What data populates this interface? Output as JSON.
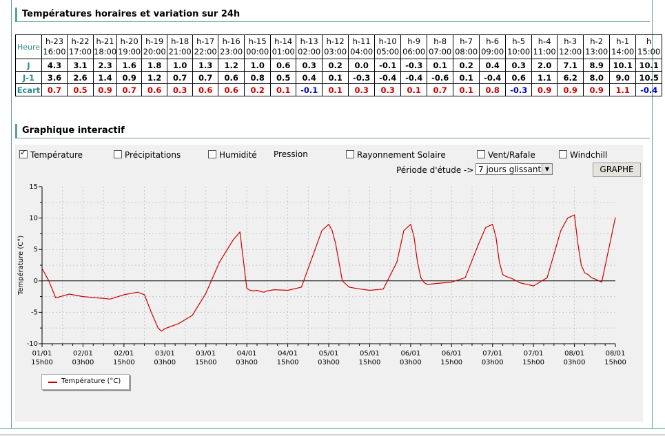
{
  "section1": {
    "title": "Températures horaires et variation sur 24h"
  },
  "table": {
    "row_labels": {
      "hour": "Heure",
      "j": "J",
      "j1": "J-1",
      "ecart": "Ecart"
    },
    "hours": [
      "h-23",
      "h-22",
      "h-21",
      "h-20",
      "h-19",
      "h-18",
      "h-17",
      "h-16",
      "h-15",
      "h-14",
      "h-13",
      "h-12",
      "h-11",
      "h-10",
      "h-9",
      "h-8",
      "h-7",
      "h-6",
      "h-5",
      "h-4",
      "h-3",
      "h-2",
      "h-1",
      "h"
    ],
    "times": [
      "16:00",
      "17:00",
      "18:00",
      "19:00",
      "20:00",
      "21:00",
      "22:00",
      "23:00",
      "00:00",
      "01:00",
      "02:00",
      "03:00",
      "04:00",
      "05:00",
      "06:00",
      "07:00",
      "08:00",
      "09:00",
      "10:00",
      "11:00",
      "12:00",
      "13:00",
      "14:00",
      "15:00"
    ],
    "j": [
      "4.3",
      "3.1",
      "2.3",
      "1.6",
      "1.8",
      "1.0",
      "1.3",
      "1.2",
      "1.0",
      "0.6",
      "0.3",
      "0.2",
      "0.0",
      "-0.1",
      "-0.3",
      "0.1",
      "0.2",
      "0.4",
      "0.3",
      "2.0",
      "7.1",
      "8.9",
      "10.1",
      "10.1"
    ],
    "j1": [
      "3.6",
      "2.6",
      "1.4",
      "0.9",
      "1.2",
      "0.7",
      "0.7",
      "0.6",
      "0.8",
      "0.5",
      "0.4",
      "0.1",
      "-0.3",
      "-0.4",
      "-0.4",
      "-0.6",
      "0.1",
      "-0.4",
      "0.6",
      "1.1",
      "6.2",
      "8.0",
      "9.0",
      "10.5"
    ],
    "ecart": [
      "0.7",
      "0.5",
      "0.9",
      "0.7",
      "0.6",
      "0.3",
      "0.6",
      "0.6",
      "0.2",
      "0.1",
      "-0.1",
      "0.1",
      "0.3",
      "0.3",
      "0.1",
      "0.7",
      "0.1",
      "0.8",
      "-0.3",
      "0.9",
      "0.9",
      "0.9",
      "1.1",
      "-0.4"
    ]
  },
  "section2": {
    "title": "Graphique interactif"
  },
  "options": {
    "temperature": {
      "label": "Température",
      "checked": true
    },
    "precipitations": {
      "label": "Précipitations",
      "checked": false
    },
    "humidite": {
      "label": "Humidité",
      "checked": false
    },
    "pression": {
      "label": "Pression"
    },
    "rayonnement": {
      "label": "Rayonnement Solaire",
      "checked": false
    },
    "vent": {
      "label": "Vent/Rafale",
      "checked": false
    },
    "windchill": {
      "label": "Windchill",
      "checked": false
    }
  },
  "period": {
    "label": "Période d'étude ->",
    "value": "7 jours glissant"
  },
  "graph_button": "GRAPHE",
  "colors": {
    "accent": "#5f9ea0",
    "positive": "#cc0000",
    "negative": "#0000cc",
    "series": "#cc0000"
  },
  "chart_data": {
    "type": "line",
    "ylabel": "Température (C°)",
    "ylim": [
      -10,
      15
    ],
    "yticks": [
      -10,
      -5,
      0,
      5,
      10,
      15
    ],
    "grid": true,
    "legend_position": "bottom-left",
    "x_tick_labels": [
      [
        "01/01",
        "15h00"
      ],
      [
        "02/01",
        "03h00"
      ],
      [
        "02/01",
        "15h00"
      ],
      [
        "03/01",
        "03h00"
      ],
      [
        "03/01",
        "15h00"
      ],
      [
        "04/01",
        "03h00"
      ],
      [
        "04/01",
        "15h00"
      ],
      [
        "05/01",
        "03h00"
      ],
      [
        "05/01",
        "15h00"
      ],
      [
        "06/01",
        "03h00"
      ],
      [
        "06/01",
        "15h00"
      ],
      [
        "07/01",
        "03h00"
      ],
      [
        "07/01",
        "15h00"
      ],
      [
        "08/01",
        "03h00"
      ],
      [
        "08/01",
        "15h00"
      ]
    ],
    "series": [
      {
        "name": "Température (°C)",
        "x_hours": [
          0,
          2,
          4,
          8,
          12,
          16,
          20,
          24,
          28,
          30,
          32,
          34,
          35,
          36,
          38,
          40,
          44,
          48,
          52,
          56,
          58,
          60,
          61,
          62,
          63,
          64,
          65,
          66,
          68,
          72,
          76,
          80,
          82,
          84,
          85,
          86,
          87,
          88,
          89,
          90,
          92,
          96,
          100,
          104,
          106,
          108,
          109,
          110,
          111,
          112,
          113,
          114,
          116,
          120,
          124,
          128,
          130,
          132,
          133,
          134,
          135,
          136,
          137,
          138,
          140,
          144,
          148,
          152,
          154,
          156,
          157,
          158,
          159,
          160,
          161,
          162,
          164,
          168
        ],
        "values": [
          2,
          0,
          -2.7,
          -2.1,
          -2.5,
          -2.7,
          -2.9,
          -2.2,
          -1.8,
          -2.2,
          -5,
          -7.5,
          -8,
          -7.6,
          -7.2,
          -6.8,
          -5.5,
          -2,
          3,
          6.5,
          7.8,
          -1.2,
          -1.5,
          -1.6,
          -1.5,
          -1.7,
          -1.8,
          -1.6,
          -1.4,
          -1.5,
          -1,
          5,
          8,
          9,
          8,
          6,
          3,
          0,
          -0.5,
          -1,
          -1.2,
          -1.5,
          -1.3,
          3,
          8,
          9,
          7,
          3,
          0.5,
          -0.3,
          -0.6,
          -0.5,
          -0.4,
          -0.2,
          0.5,
          6,
          8.5,
          9,
          7,
          3,
          1,
          0.7,
          0.5,
          0.3,
          -0.3,
          -0.8,
          0.5,
          8,
          10,
          10.5,
          6,
          2.5,
          1.3,
          1,
          0.5,
          0.3,
          -0.2,
          10.1
        ]
      }
    ]
  }
}
